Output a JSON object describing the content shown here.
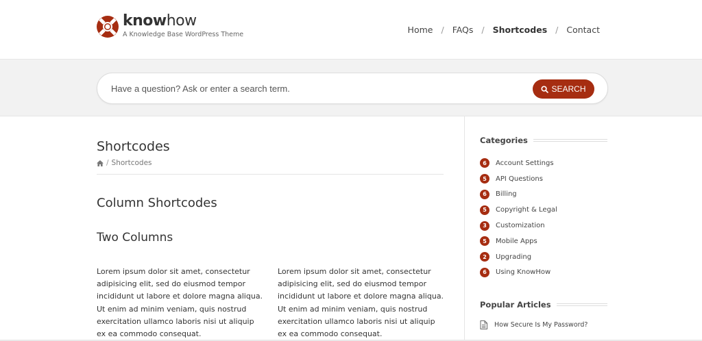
{
  "brand": {
    "name_bold": "know",
    "name_light": "how",
    "tagline": "A Knowledge Base WordPress Theme",
    "accent_color": "#a62d11"
  },
  "nav": {
    "items": [
      {
        "label": "Home",
        "active": false
      },
      {
        "label": "FAQs",
        "active": false
      },
      {
        "label": "Shortcodes",
        "active": true
      },
      {
        "label": "Contact",
        "active": false
      }
    ],
    "separator": "/"
  },
  "search": {
    "placeholder": "Have a question? Ask or enter a search term.",
    "button_label": "SEARCH",
    "button_icon": "search-icon"
  },
  "page": {
    "title": "Shortcodes",
    "breadcrumb": {
      "home_icon": "home-icon",
      "separator": "/",
      "current": "Shortcodes"
    },
    "section_title": "Column Shortcodes",
    "subsection_title": "Two Columns",
    "col1_text": "Lorem ipsum dolor sit amet, consectetur adipisicing elit, sed do eiusmod tempor incididunt ut labore et dolore magna aliqua. Ut enim ad minim veniam, quis nostrud exercitation ullamco laboris nisi ut aliquip ex ea commodo consequat.",
    "col2_text": "Lorem ipsum dolor sit amet, consectetur adipisicing elit, sed do eiusmod tempor incididunt ut labore et dolore magna aliqua. Ut enim ad minim veniam, quis nostrud exercitation ullamco laboris nisi ut aliquip ex ea commodo consequat."
  },
  "sidebar": {
    "categories_title": "Categories",
    "categories": [
      {
        "count": "6",
        "label": "Account Settings"
      },
      {
        "count": "5",
        "label": "API Questions"
      },
      {
        "count": "6",
        "label": "Billing"
      },
      {
        "count": "5",
        "label": "Copyright & Legal"
      },
      {
        "count": "3",
        "label": "Customization"
      },
      {
        "count": "5",
        "label": "Mobile Apps"
      },
      {
        "count": "2",
        "label": "Upgrading"
      },
      {
        "count": "6",
        "label": "Using KnowHow"
      }
    ],
    "popular_title": "Popular Articles",
    "popular": [
      {
        "icon": "document-icon",
        "label": "How Secure Is My Password?"
      }
    ]
  }
}
